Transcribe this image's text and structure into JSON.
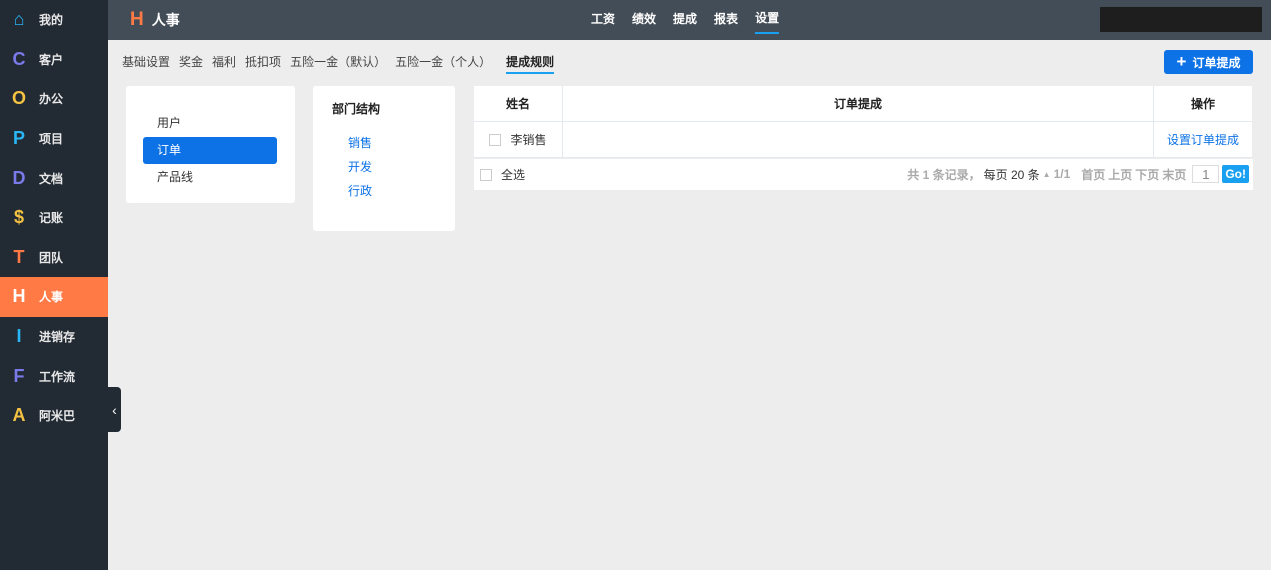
{
  "sidebar": {
    "items": [
      {
        "label": "我的",
        "icon": "⌂",
        "color": "#29b6f6"
      },
      {
        "label": "客户",
        "icon": "C",
        "color": "#7a7aea"
      },
      {
        "label": "办公",
        "icon": "O",
        "color": "#f5c342"
      },
      {
        "label": "项目",
        "icon": "P",
        "color": "#29b6f6"
      },
      {
        "label": "文档",
        "icon": "D",
        "color": "#7a7aea"
      },
      {
        "label": "记账",
        "icon": "$",
        "color": "#f5c342"
      },
      {
        "label": "团队",
        "icon": "T",
        "color": "#ff7a45"
      },
      {
        "label": "人事",
        "icon": "H",
        "color": "#ffffff"
      },
      {
        "label": "进销存",
        "icon": "I",
        "color": "#29b6f6"
      },
      {
        "label": "工作流",
        "icon": "F",
        "color": "#7a7aea"
      },
      {
        "label": "阿米巴",
        "icon": "A",
        "color": "#f5c342"
      }
    ]
  },
  "header": {
    "logo": "H",
    "title": "人事",
    "nav": [
      "工资",
      "绩效",
      "提成",
      "报表",
      "设置"
    ]
  },
  "tabs": [
    "基础设置",
    "奖金",
    "福利",
    "抵扣项",
    "五险一金（默认）",
    "五险一金（个人）",
    "提成规则"
  ],
  "add_button": "订单提成",
  "left_menu": [
    "用户",
    "订单",
    "产品线"
  ],
  "dept": {
    "title": "部门结构",
    "items": [
      "销售",
      "开发",
      "行政"
    ]
  },
  "table": {
    "headers": [
      "姓名",
      "订单提成",
      "操作"
    ],
    "rows": [
      {
        "name": "李销售",
        "action": "设置订单提成"
      }
    ]
  },
  "footer": {
    "select_all": "全选",
    "total": "共 1 条记录，",
    "per_page": "每页 20 条",
    "page": "1/1",
    "first": "首页",
    "prev": "上页",
    "next": "下页",
    "last": "末页",
    "page_input": "1",
    "go": "Go!"
  }
}
